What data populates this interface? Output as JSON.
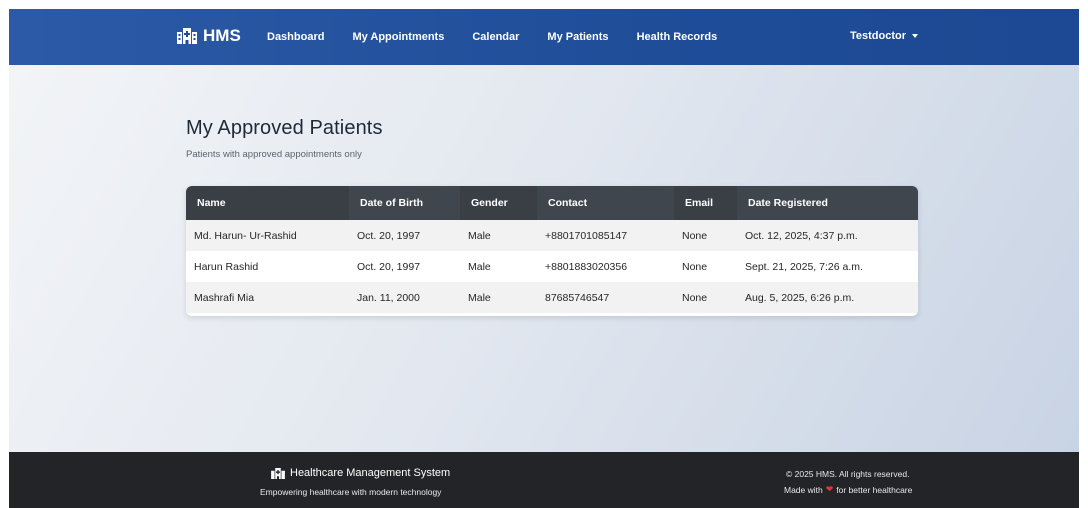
{
  "navbar": {
    "brand": "HMS",
    "links": [
      "Dashboard",
      "My Appointments",
      "Calendar",
      "My Patients",
      "Health Records"
    ],
    "user": "Testdoctor"
  },
  "page": {
    "title": "My Approved Patients",
    "subtitle": "Patients with approved appointments only"
  },
  "table": {
    "columns": [
      "Name",
      "Date of Birth",
      "Gender",
      "Contact",
      "Email",
      "Date Registered"
    ],
    "rows": [
      [
        "Md. Harun- Ur-Rashid",
        "Oct. 20, 1997",
        "Male",
        "+8801701085147",
        "None",
        "Oct. 12, 2025, 4:37 p.m."
      ],
      [
        "Harun Rashid",
        "Oct. 20, 1997",
        "Male",
        "+8801883020356",
        "None",
        "Sept. 21, 2025, 7:26 a.m."
      ],
      [
        "Mashrafi Mia",
        "Jan. 11, 2000",
        "Male",
        "87685746547",
        "None",
        "Aug. 5, 2025, 6:26 p.m."
      ]
    ]
  },
  "footer": {
    "brand": "Healthcare Management System",
    "tagline": "Empowering healthcare with modern technology",
    "copyright": "© 2025 HMS. All rights reserved.",
    "love_prefix": "Made with",
    "love_suffix": "for better healthcare",
    "heart_color": "#e0353b",
    "icon": "hospital-icon"
  }
}
